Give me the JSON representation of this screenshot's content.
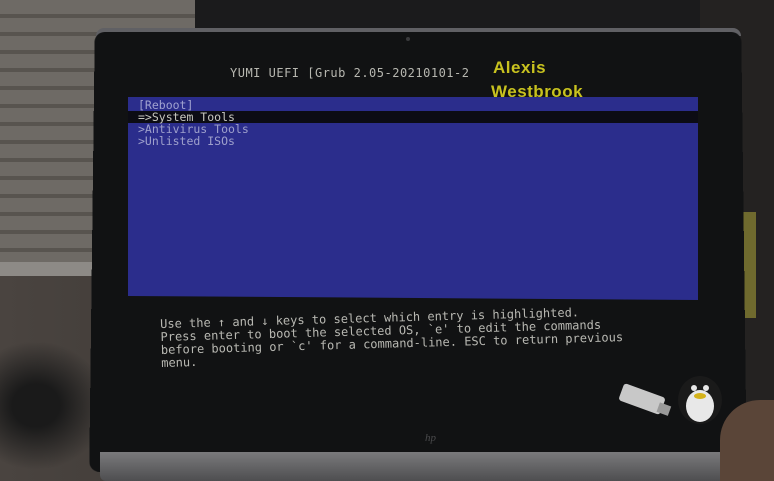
{
  "grub": {
    "title": "YUMI UEFI [Grub 2.05-20210101-2",
    "menu_items": [
      {
        "label": "[Reboot]",
        "state": "normal"
      },
      {
        "label": "=>System Tools",
        "state": "selected"
      },
      {
        "label": ">Antivirus Tools",
        "state": "normal"
      },
      {
        "label": ">Unlisted ISOs",
        "state": "normal"
      }
    ],
    "help_lines": [
      "Use the ↑ and ↓ keys to select which entry is highlighted.",
      "Press enter to boot the selected OS, `e' to edit the commands",
      "before booting or `c' for a command-line. ESC to return previous",
      "menu."
    ]
  },
  "watermark": {
    "line1": "Alexis",
    "line2": "Westbrook",
    "color": "#c8c21f"
  },
  "laptop": {
    "brand_mark": "hp"
  },
  "colors": {
    "menu_bg": "#2b2d8c",
    "highlight_bg": "#0c0c14",
    "screen_bg": "#111213",
    "text": "#b9b9b3"
  },
  "icons": {
    "sticker": "usb-penguin-sticker"
  }
}
